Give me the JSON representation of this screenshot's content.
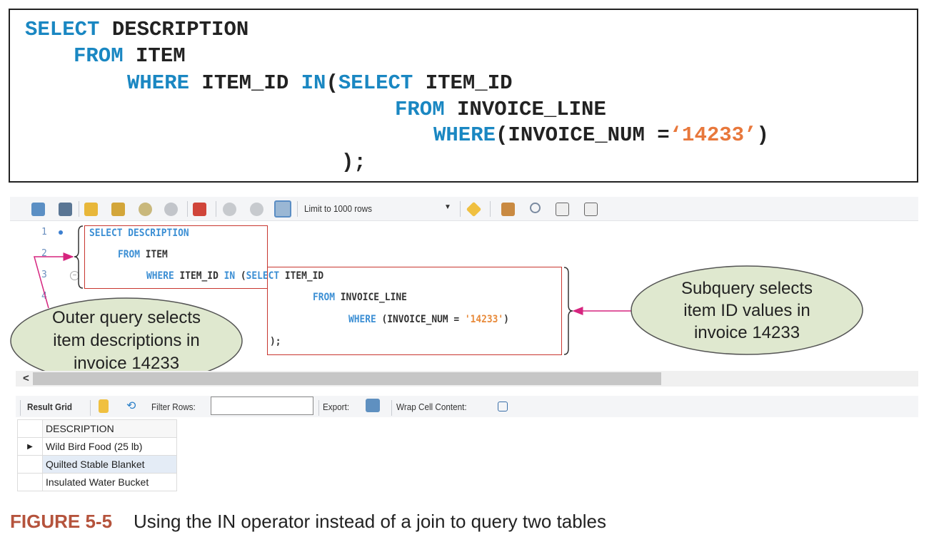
{
  "code_box": {
    "lines": [
      {
        "kw1": "SELECT",
        "rest": " DESCRIPTION"
      },
      {
        "kw1": "FROM",
        "rest": " ITEM"
      },
      {
        "kw1": "WHERE",
        "mid": " ITEM_ID ",
        "kw2": "IN",
        "paren": "(",
        "kw3": "SELECT",
        "rest": " ITEM_ID"
      },
      {
        "kw1": "FROM",
        "rest": " INVOICE_LINE"
      },
      {
        "kw1": "WHERE",
        "mid": "(INVOICE_NUM =",
        "str": "‘14233’",
        "rest": ")"
      },
      {
        "rest": ");"
      }
    ]
  },
  "toolbar": {
    "limit_select": "Limit to 1000 rows",
    "icons": [
      "open-folder-icon",
      "save-icon",
      "execute-icon",
      "execute-current-icon",
      "explain-icon",
      "stop-icon",
      "toggle-error-icon",
      "commit-icon",
      "rollback-icon",
      "autocommit-icon",
      "bookmark-icon",
      "beautify-icon",
      "find-icon",
      "invisible-chars-icon",
      "wrap-icon"
    ]
  },
  "editor": {
    "line_numbers": [
      "1",
      "2",
      "3",
      "4"
    ],
    "l1": {
      "kw": "SELECT DESCRIPTION"
    },
    "l2": {
      "kw": "FROM",
      "rest": " ITEM"
    },
    "l3": {
      "kw": "WHERE",
      "mid": " ITEM_ID ",
      "kw2": "IN",
      "sp": " (",
      "kw3": "SELECT",
      "rest": " ITEM_ID"
    },
    "l4": {
      "kw": "FROM",
      "rest": " INVOICE_LINE"
    },
    "l5": {
      "kw": "WHERE",
      "mid": " (INVOICE_NUM = ",
      "str": "'14233'",
      "rest": ")"
    },
    "l6": {
      "rest": ");"
    }
  },
  "callouts": {
    "outer": [
      "Outer query selects",
      "item descriptions in",
      "invoice 14233"
    ],
    "sub": [
      "Subquery selects",
      "item ID values in",
      "invoice 14233"
    ]
  },
  "scroll_left": "<",
  "result_toolbar": {
    "result_grid": "Result Grid",
    "filter_rows": "Filter Rows:",
    "filter_value": "",
    "export": "Export:",
    "wrap": "Wrap Cell Content:"
  },
  "result_table": {
    "header": "DESCRIPTION",
    "rows": [
      "Wild Bird Food (25 lb)",
      "Quilted Stable Blanket",
      "Insulated Water Bucket"
    ],
    "selected_marker": "▶"
  },
  "caption": {
    "label": "FIGURE 5-5",
    "text": "Using the IN operator instead of a join to query two tables"
  },
  "colors": {
    "keyword": "#1a87c2",
    "string": "#e8783c",
    "callout_fill": "#dfe8cf",
    "arrow": "#d6257f",
    "highlight_box": "#c8362f",
    "caption_label": "#b5533c"
  }
}
